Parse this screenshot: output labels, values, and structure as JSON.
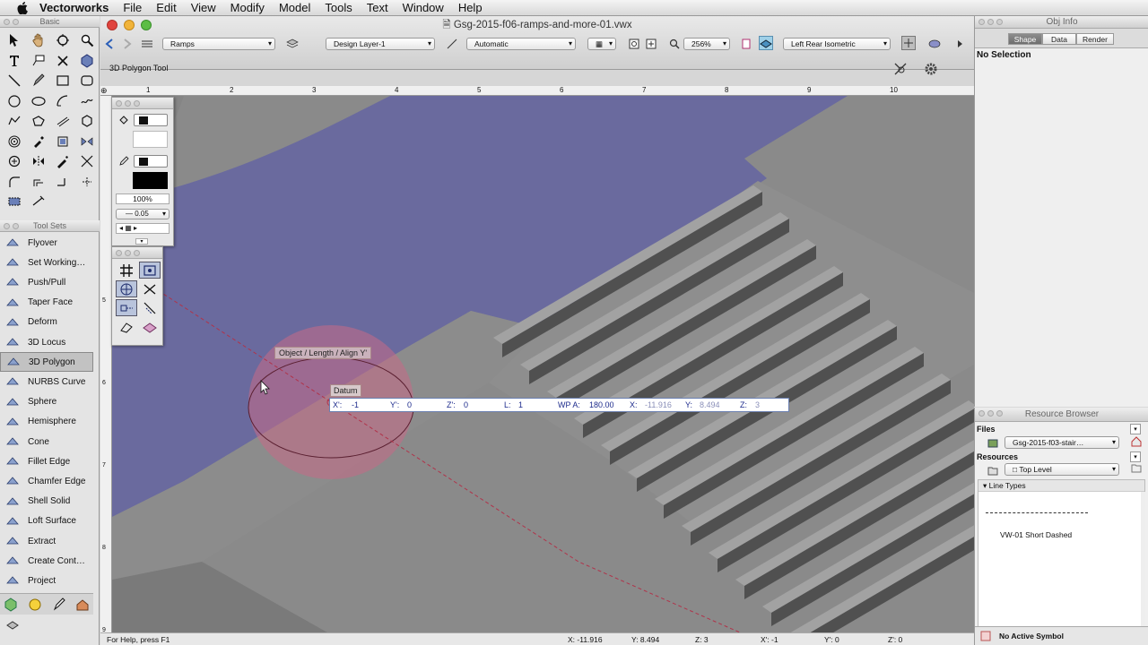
{
  "menubar": {
    "app": "Vectorworks",
    "items": [
      "File",
      "Edit",
      "View",
      "Modify",
      "Model",
      "Tools",
      "Text",
      "Window",
      "Help"
    ]
  },
  "basic_palette": {
    "title": "Basic"
  },
  "toolsets": {
    "title": "Tool Sets",
    "items": [
      "Flyover",
      "Set Working…",
      "Push/Pull",
      "Taper Face",
      "Deform",
      "3D Locus",
      "3D Polygon",
      "NURBS Curve",
      "Sphere",
      "Hemisphere",
      "Cone",
      "Fillet Edge",
      "Chamfer Edge",
      "Shell Solid",
      "Loft Surface",
      "Extract",
      "Create Cont…",
      "Project"
    ],
    "selected": "3D Polygon"
  },
  "document": {
    "title": "Gsg-2015-f06-ramps-and-more-01.vwx",
    "class_select": "Ramps",
    "layer_select": "Design Layer-1",
    "render_select": "Automatic",
    "zoom": "256%",
    "view_select": "Left Rear Isometric",
    "tool_name": "3D Polygon Tool",
    "ruler_top": [
      "1",
      "2",
      "3",
      "4",
      "5",
      "6",
      "7",
      "8",
      "9",
      "10"
    ],
    "ruler_left": [
      "5",
      "6",
      "7",
      "8",
      "9"
    ]
  },
  "attributes": {
    "opacity": "100%",
    "line_weight": "0.05"
  },
  "canvas": {
    "smart_cursor_cue": "Object / Length / Align Y'",
    "datum_label": "Datum"
  },
  "data_bar": [
    {
      "label": "X':",
      "value": "-1"
    },
    {
      "label": "Y':",
      "value": "0"
    },
    {
      "label": "Z':",
      "value": "0"
    },
    {
      "label": "L:",
      "value": "1"
    },
    {
      "label": "WP A:",
      "value": "180.00"
    },
    {
      "label": "X:",
      "value": "-11.916"
    },
    {
      "label": "Y:",
      "value": "8.494"
    },
    {
      "label": "Z:",
      "value": "3"
    }
  ],
  "status": {
    "help": "For Help, press F1",
    "x": "X: -11.916",
    "y": "Y: 8.494",
    "z": "Z: 3",
    "xp": "X': -1",
    "yp": "Y': 0",
    "zp": "Z': 0"
  },
  "obj_info": {
    "title": "Obj Info",
    "tabs": [
      "Shape",
      "Data",
      "Render"
    ],
    "active_tab": "Shape",
    "selection": "No Selection"
  },
  "resource_browser": {
    "title": "Resource Browser",
    "files_label": "Files",
    "file_select": "Gsg-2015-f03-stair…",
    "resources_label": "Resources",
    "resources_select": "Top Level",
    "section": "Line Types",
    "line_type_name": "VW-01 Short Dashed",
    "active_symbol": "No Active Symbol"
  },
  "colors": {
    "water": "#6a6a9e",
    "sphere": "#c76a86",
    "ground": "#8c8c8c"
  }
}
